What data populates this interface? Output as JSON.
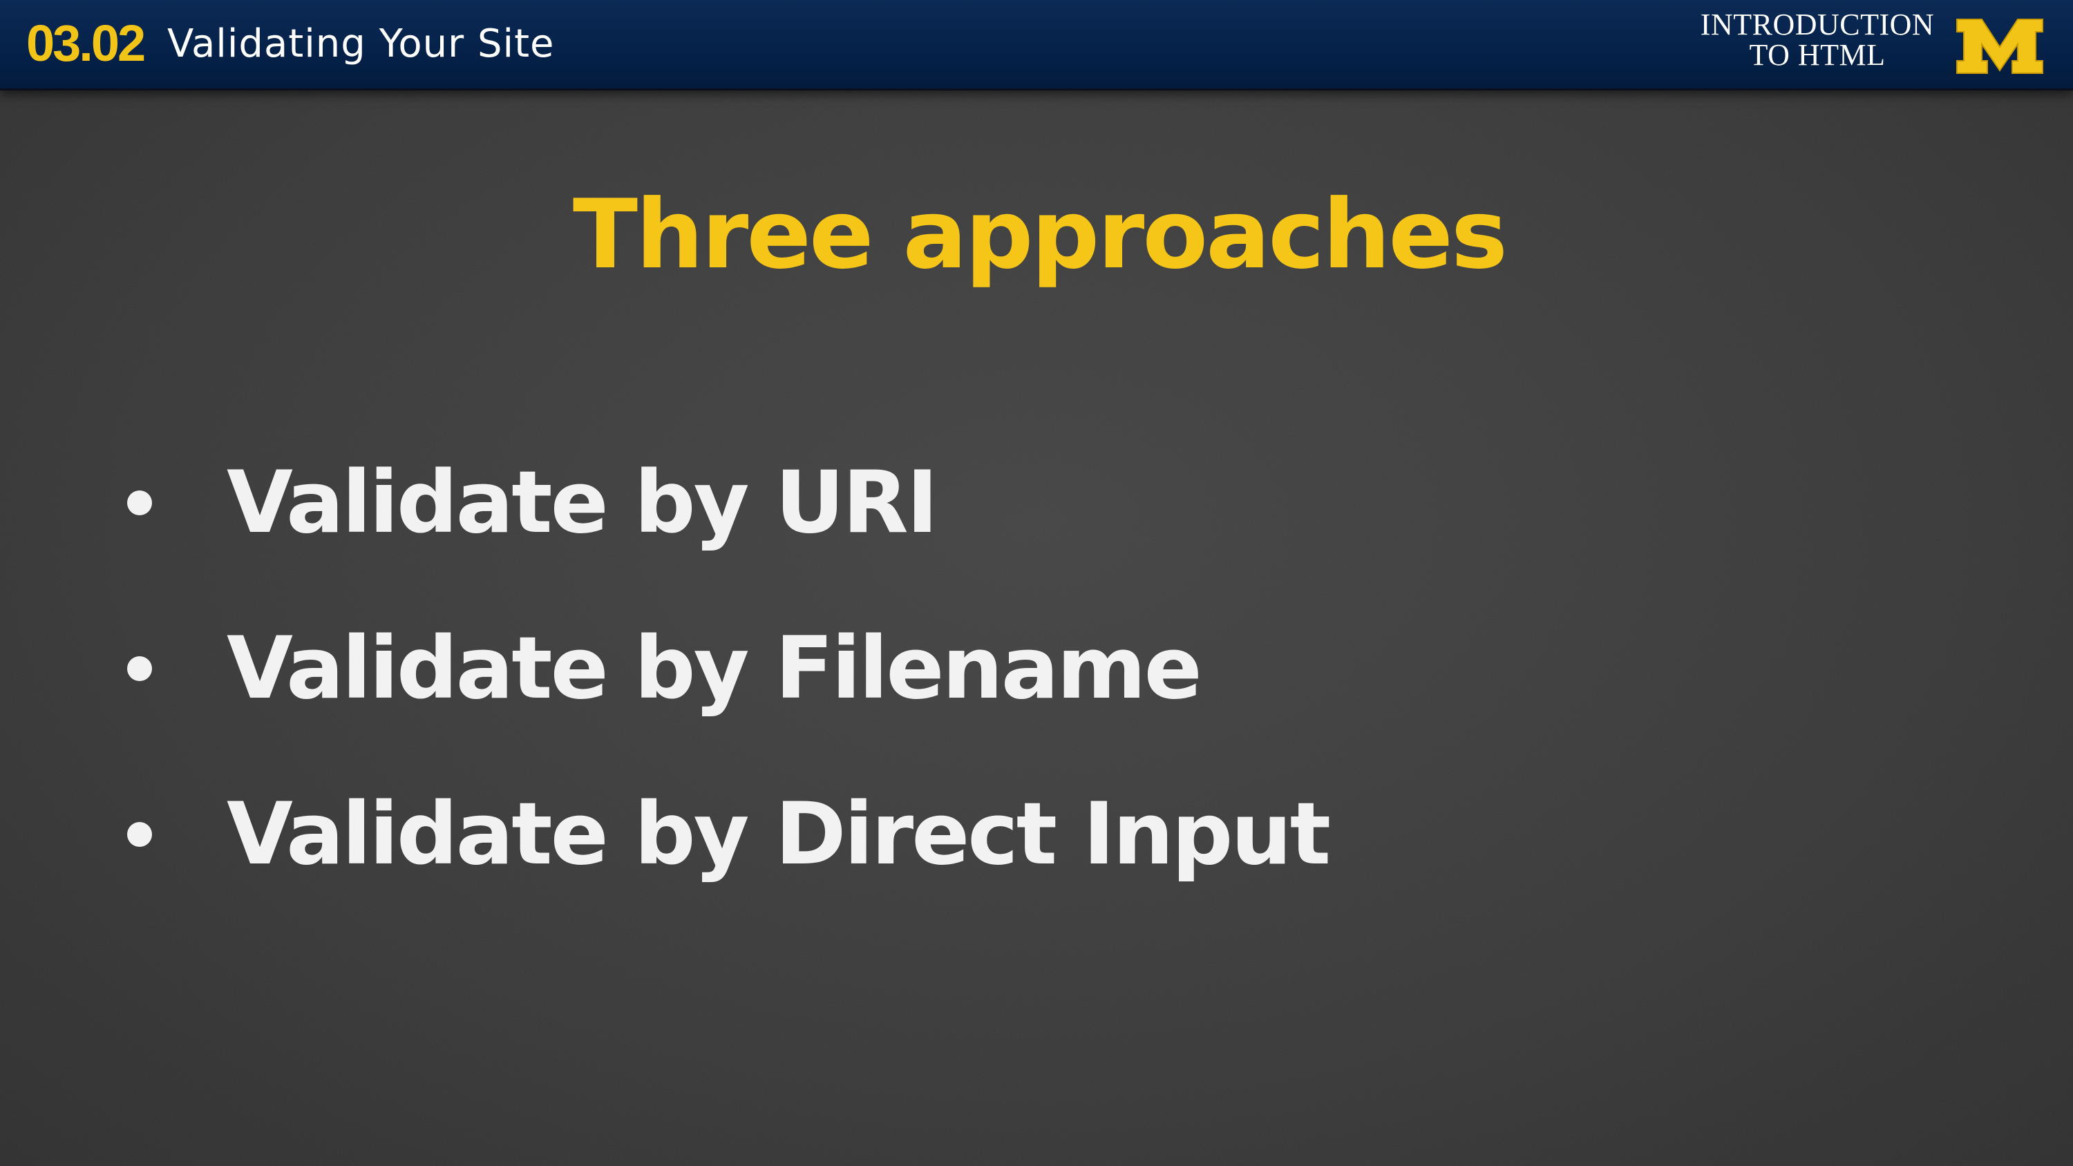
{
  "header": {
    "lesson_number": "03.02",
    "lesson_title": "Validating Your Site",
    "course_title_line1": "INTRODUCTION",
    "course_title_line2": "TO HTML",
    "logo_letter": "M",
    "bar_color": "#05224a",
    "accent_color": "#f3c418"
  },
  "slide": {
    "heading": "Three approaches",
    "heading_color": "#f5c518",
    "bullets": [
      "Validate by URI",
      "Validate by Filename",
      "Validate by Direct Input"
    ],
    "bullet_color": "#f2f2f2",
    "background_color": "#3c3c3c"
  }
}
